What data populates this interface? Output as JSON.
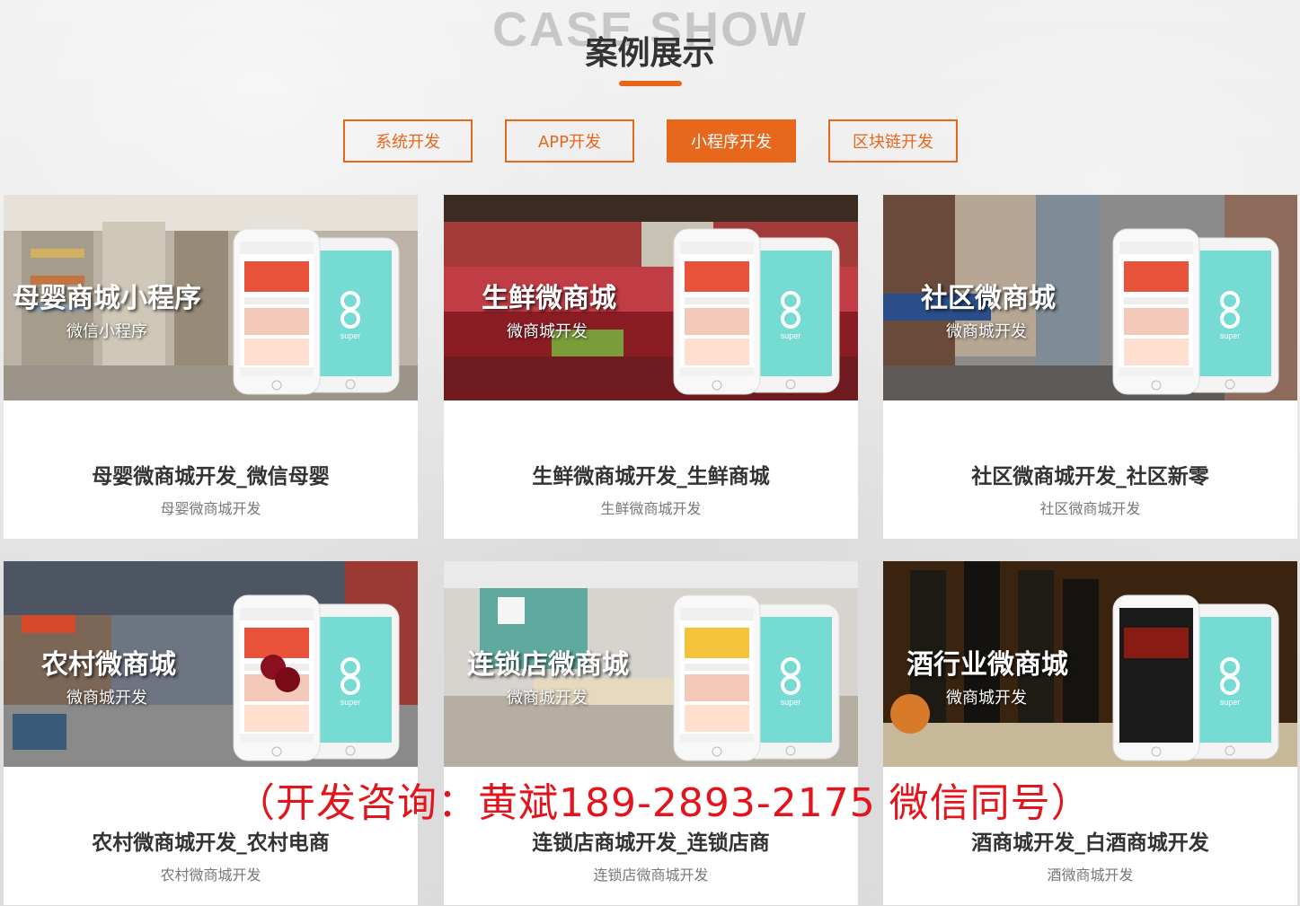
{
  "header": {
    "en_title": "CASE SHOW",
    "cn_title": "案例展示"
  },
  "tabs": [
    {
      "label": "系统开发",
      "active": false
    },
    {
      "label": "APP开发",
      "active": false
    },
    {
      "label": "小程序开发",
      "active": true
    },
    {
      "label": "区块链开发",
      "active": false
    }
  ],
  "cards": [
    {
      "overlay_title": "母婴商城小程序",
      "overlay_sub": "微信小程序",
      "name": "母婴微商城开发_微信母婴",
      "desc": "母婴微商城开发"
    },
    {
      "overlay_title": "生鲜微商城",
      "overlay_sub": "微商城开发",
      "name": "生鲜微商城开发_生鲜商城",
      "desc": "生鲜微商城开发"
    },
    {
      "overlay_title": "社区微商城",
      "overlay_sub": "微商城开发",
      "name": "社区微商城开发_社区新零",
      "desc": "社区微商城开发"
    },
    {
      "overlay_title": "农村微商城",
      "overlay_sub": "微商城开发",
      "name": "农村微商城开发_农村电商",
      "desc": "农村微商城开发"
    },
    {
      "overlay_title": "连锁店微商城",
      "overlay_sub": "微商城开发",
      "name": "连锁店商城开发_连锁店商",
      "desc": "连锁店微商城开发"
    },
    {
      "overlay_title": "酒行业微商城",
      "overlay_sub": "微商城开发",
      "name": "酒商城开发_白酒商城开发",
      "desc": "酒微商城开发"
    }
  ],
  "phone_brand": "super",
  "consult_text": "（开发咨询：黄斌189-2893-2175 微信同号）",
  "colors": {
    "accent": "#e7681d",
    "phone_screen": "#76dcd3",
    "consult": "#e3141b"
  }
}
